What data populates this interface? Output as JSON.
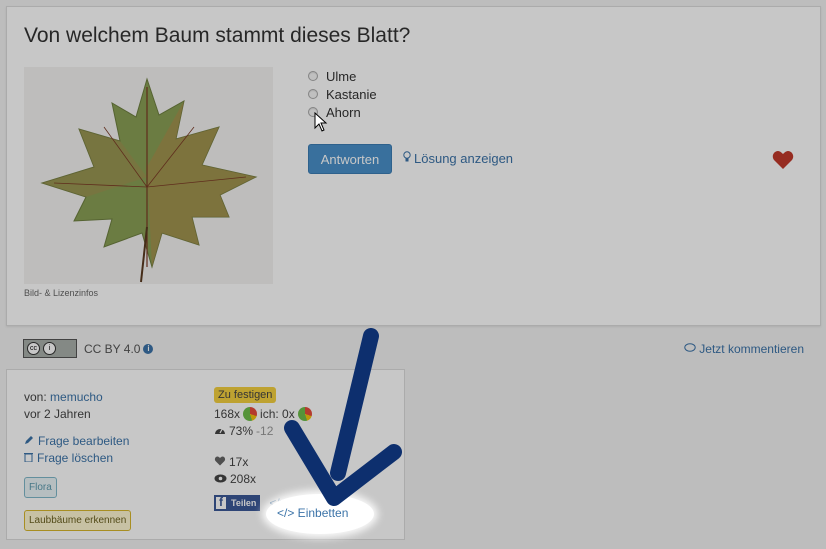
{
  "question": {
    "title": "Von welchem Baum stammt dieses Blatt?",
    "image_caption": "Bild- & Lizenzinfos",
    "image_icon": "maple-leaf-image",
    "answers": [
      "Ulme",
      "Kastanie",
      "Ahorn"
    ],
    "answer_button": "Antworten",
    "show_solution": "Lösung anzeigen",
    "favorite_icon": "heart-icon"
  },
  "license": {
    "badge_text": "cc by",
    "label": "CC BY 4.0",
    "info_glyph": "i",
    "comment_link": "Jetzt kommentieren"
  },
  "info": {
    "author_prefix": "von:",
    "author": "memucho",
    "age": "vor 2 Jahren",
    "edit_label": "Frage bearbeiten",
    "delete_label": "Frage löschen",
    "category_tag": "Flora",
    "set_tag": "Laubbäume erkennen",
    "status": "Zu festigen",
    "answered_count": "168x",
    "my_count": "ich: 0x",
    "correct_rate": "73%",
    "correct_delta": "-12",
    "likes": "17x",
    "views": "208x",
    "share_label": "Teilen",
    "embed_label": "</> Einbetten"
  },
  "colors": {
    "link": "#3b73a8",
    "primary_button": "#4a90c9",
    "heart": "#c0392b",
    "arrow": "#0d2f6e",
    "status_badge": "#f4d03f"
  }
}
